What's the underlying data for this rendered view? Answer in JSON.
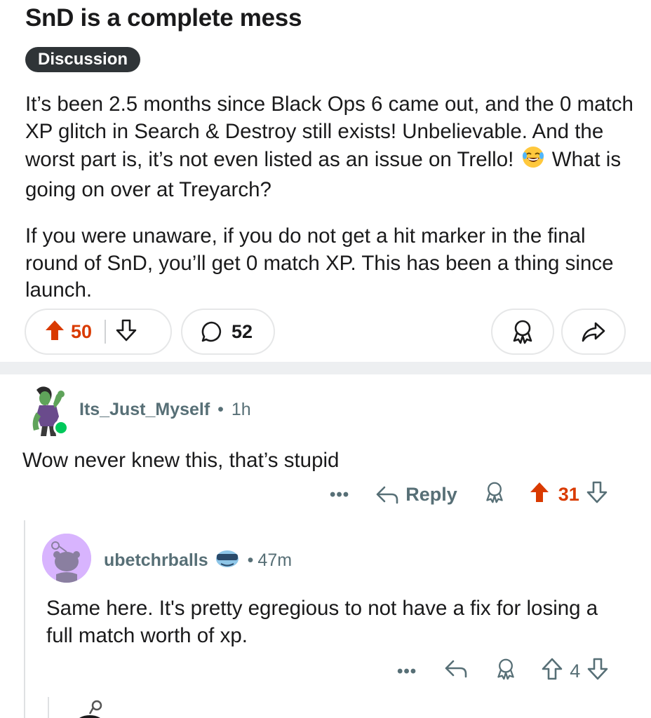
{
  "post": {
    "title": "SnD is a complete mess",
    "flair": "Discussion",
    "body_p1_a": "It’s been 2.5 months since Black Ops 6 came out, and the 0 match XP glitch in Search & Destroy still exists! Unbelievable. And the worst part is, it’s not even listed as an issue on Trello!",
    "body_p1_b": "What is going on over at Treyarch?",
    "body_p2": "If you were unaware, if you do not get a hit marker in the final round of SnD, you’ll get 0 match XP. This has been a thing since launch.",
    "upvotes": "50",
    "comments": "52"
  },
  "comments": [
    {
      "username": "Its_Just_Myself",
      "separator": "•",
      "time": "1h",
      "body": "Wow never knew this, that’s stupid",
      "more": "•••",
      "reply_label": "Reply",
      "votes": "31"
    },
    {
      "username": "ubetchrballs",
      "separator": "•",
      "time": "47m",
      "body": "Same here. It's pretty egregious to not have a fix for losing a full match worth of xp.",
      "more": "•••",
      "votes": "4"
    }
  ],
  "colors": {
    "upvote_active": "#d93a00",
    "meta_gray": "#576f76",
    "flair_bg": "#2f3437",
    "online": "#00c85a"
  },
  "icons": [
    "upvote-icon",
    "downvote-icon",
    "comment-icon",
    "award-icon",
    "share-icon",
    "reply-icon",
    "more-icon",
    "laughing-emoji",
    "sunglasses-badge-icon"
  ]
}
